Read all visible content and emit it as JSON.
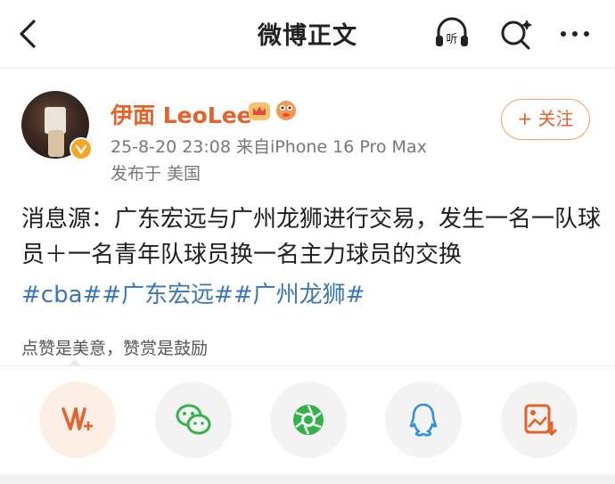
{
  "nav": {
    "title": "微博正文"
  },
  "post": {
    "username": "伊面 LeoLee",
    "meta": "25-8-20 23:08 来自iPhone 16 Pro Max",
    "location": "发布于 美国",
    "follow_label": "+ 关注",
    "body": "消息源：广东宏远与广州龙狮进行交易，发生一名一队球员＋一名青年队球员换一名主力球员的交换",
    "tags": "#cba##广东宏远##广州龙狮#"
  },
  "reward": {
    "label": "点赞是美意，赞赏是鼓励"
  },
  "colors": {
    "accent": "#e5622a",
    "tag": "#3b76b5",
    "wechat": "#33b34a",
    "qq": "#2f8fe0"
  },
  "share_icons": [
    "reward-icon",
    "wechat-icon",
    "moments-icon",
    "qq-icon",
    "save-image-icon"
  ]
}
